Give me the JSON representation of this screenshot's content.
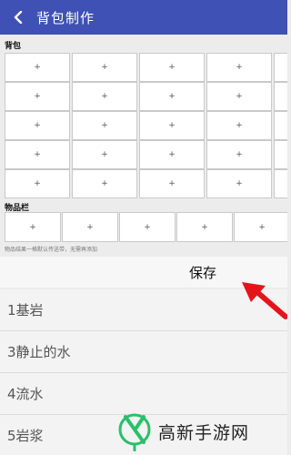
{
  "appbar": {
    "title": "背包制作",
    "back_icon": "back-arrow-icon"
  },
  "bag": {
    "label": "背包",
    "rows": 5,
    "cols": 5,
    "cell_symbol": "+"
  },
  "items": {
    "label": "物品栏",
    "count": 5,
    "cell_symbol": "+",
    "hint": "物品结果一格默认传送带，无需再添加"
  },
  "save": {
    "label": "保存"
  },
  "blocks": [
    {
      "label": "1基岩"
    },
    {
      "label": "3静止的水"
    },
    {
      "label": "4流水"
    },
    {
      "label": "5岩浆"
    }
  ],
  "watermark": {
    "text": "高新手游网"
  },
  "colors": {
    "appbar": "#3f51b5",
    "arrow": "#e5141b",
    "logo_green": "#2bbf6a"
  }
}
